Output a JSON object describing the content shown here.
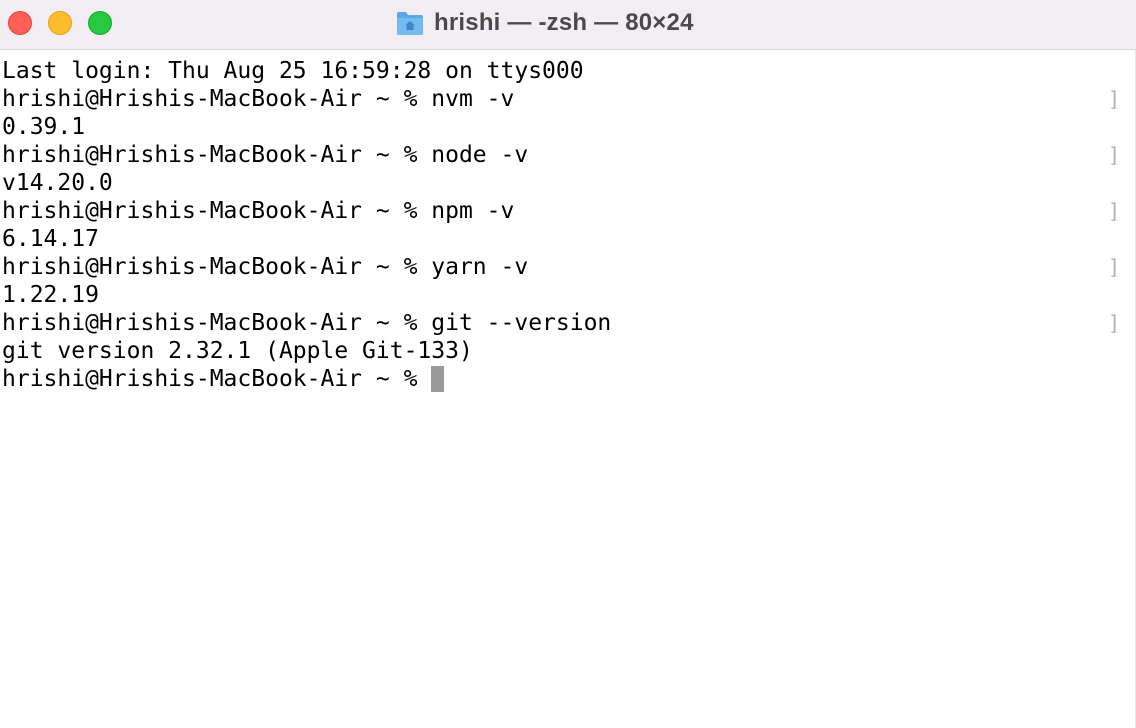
{
  "window": {
    "title": "hrishi — -zsh — 80×24",
    "title_icon": "home-folder-icon"
  },
  "terminal": {
    "login_line": "Last login: Thu Aug 25 16:59:28 on ttys000",
    "entries": [
      {
        "prompt": "hrishi@Hrishis-MacBook-Air ~ % ",
        "command": "nvm -v",
        "output": "0.39.1"
      },
      {
        "prompt": "hrishi@Hrishis-MacBook-Air ~ % ",
        "command": "node -v",
        "output": "v14.20.0"
      },
      {
        "prompt": "hrishi@Hrishis-MacBook-Air ~ % ",
        "command": "npm -v",
        "output": "6.14.17"
      },
      {
        "prompt": "hrishi@Hrishis-MacBook-Air ~ % ",
        "command": "yarn -v",
        "output": "1.22.19"
      },
      {
        "prompt": "hrishi@Hrishis-MacBook-Air ~ % ",
        "command": "git --version",
        "output": "git version 2.32.1 (Apple Git-133)"
      }
    ],
    "current_prompt": "hrishi@Hrishis-MacBook-Air ~ % ",
    "mark_glyph": "]"
  },
  "colors": {
    "close": "#fe5f57",
    "minimize": "#febc2e",
    "zoom": "#28c840",
    "titlebar": "#f3eef3",
    "cursor": "#9a9a9a"
  }
}
